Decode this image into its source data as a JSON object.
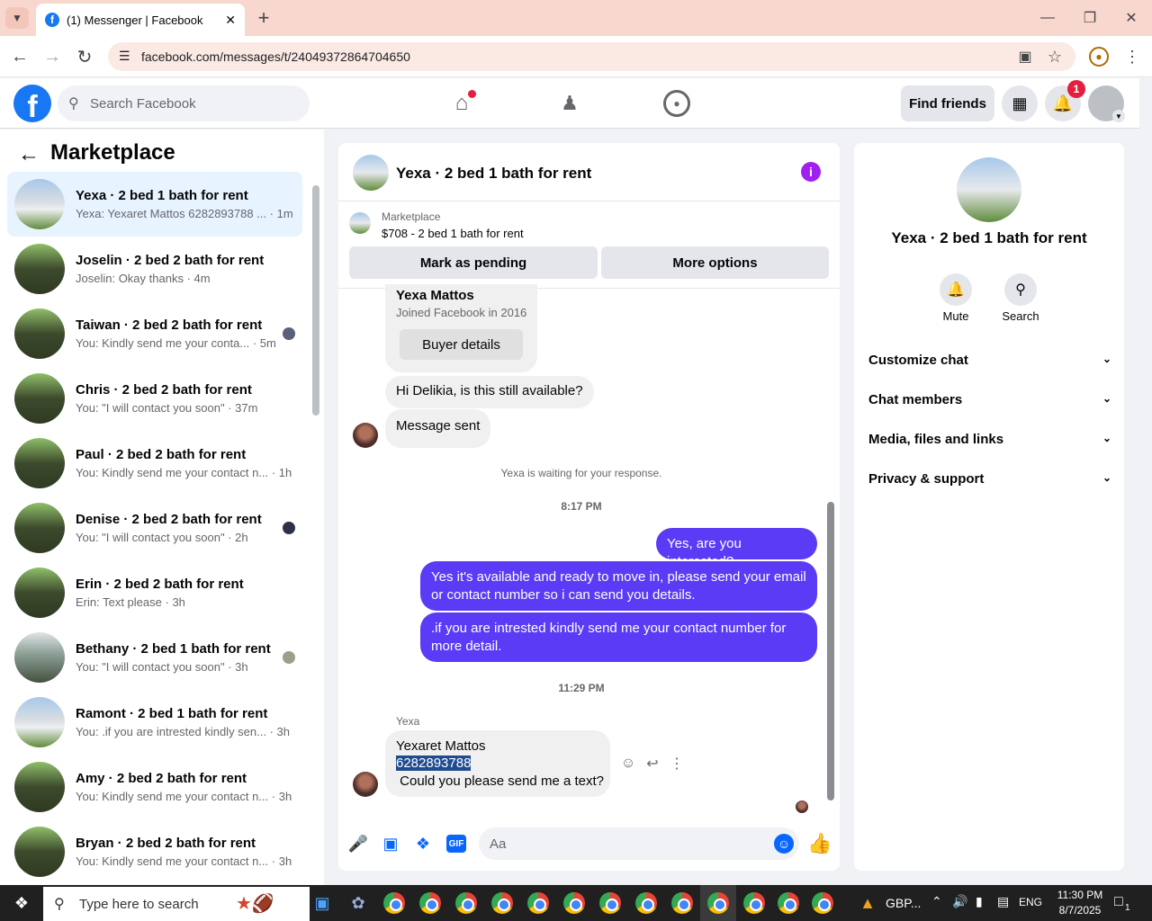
{
  "browser": {
    "tab_title": "(1) Messenger | Facebook",
    "url": "facebook.com/messages/t/24049372864704650"
  },
  "header": {
    "search_placeholder": "Search Facebook",
    "find_friends": "Find friends",
    "notif_count": "1"
  },
  "sidebar": {
    "title": "Marketplace",
    "conversations": [
      {
        "name": "Yexa · 2 bed 1 bath for rent",
        "preview": "Yexa: Yexaret Mattos 6282893788 ...",
        "time": "· 1m"
      },
      {
        "name": "Joselin · 2 bed 2 bath for rent",
        "preview": "Joselin: Okay thanks",
        "time": "· 4m"
      },
      {
        "name": "Taiwan · 2 bed 2 bath for rent",
        "preview": "You: Kindly send me your conta...",
        "time": "· 5m"
      },
      {
        "name": "Chris · 2 bed 2 bath for rent",
        "preview": "You: \"I will contact you soon\"",
        "time": "· 37m"
      },
      {
        "name": "Paul · 2 bed 2 bath for rent",
        "preview": "You: Kindly send me your contact n...",
        "time": "· 1h"
      },
      {
        "name": "Denise · 2 bed 2 bath for rent",
        "preview": "You: \"I will contact you soon\"",
        "time": "· 2h"
      },
      {
        "name": "Erin · 2 bed 2 bath for rent",
        "preview": "Erin: Text please",
        "time": "· 3h"
      },
      {
        "name": "Bethany · 2 bed 1 bath for rent",
        "preview": "You: \"I will contact you soon\"",
        "time": "· 3h"
      },
      {
        "name": "Ramont · 2 bed 1 bath for rent",
        "preview": "You: .if you are intrested kindly sen...",
        "time": "· 3h"
      },
      {
        "name": "Amy · 2 bed 2 bath for rent",
        "preview": "You: Kindly send me your contact n...",
        "time": "· 3h"
      },
      {
        "name": "Bryan · 2 bed 2 bath for rent",
        "preview": "You: Kindly send me your contact n...",
        "time": "· 3h"
      }
    ]
  },
  "chat": {
    "title": "Yexa · 2 bed 1 bath for rent",
    "listing_label": "Marketplace",
    "listing_title": "$708 - 2 bed 1 bath for rent",
    "mark_pending": "Mark as pending",
    "more_options": "More options",
    "buyer_name": "Yexa Mattos",
    "buyer_joined": "Joined Facebook in 2016",
    "buyer_details": "Buyer details",
    "msg_hi": "Hi Delikia, is this still available?",
    "msg_sent": "Message sent",
    "waiting": "Yexa is waiting for your response.",
    "time1": "8:17 PM",
    "out1": "Yes, are you interested?",
    "out2": "Yes it's available and ready to move in, please send your email or contact number so i can send you details.",
    "out3": ".if you are intrested kindly send me your contact number for more detail.",
    "time2": "11:29 PM",
    "sender_label": "Yexa",
    "last_line1": "Yexaret Mattos",
    "last_line2": "6282893788",
    "last_line3": " Could you please send me a text?",
    "composer_placeholder": "Aa"
  },
  "panel": {
    "title": "Yexa · 2 bed 1 bath for rent",
    "mute": "Mute",
    "search": "Search",
    "items": [
      "Customize chat",
      "Chat members",
      "Media, files and links",
      "Privacy & support"
    ]
  },
  "taskbar": {
    "search_placeholder": "Type here to search",
    "currency": "GBP...",
    "lang": "ENG",
    "time": "11:30 PM",
    "date": "8/7/2025",
    "notif": "1"
  }
}
